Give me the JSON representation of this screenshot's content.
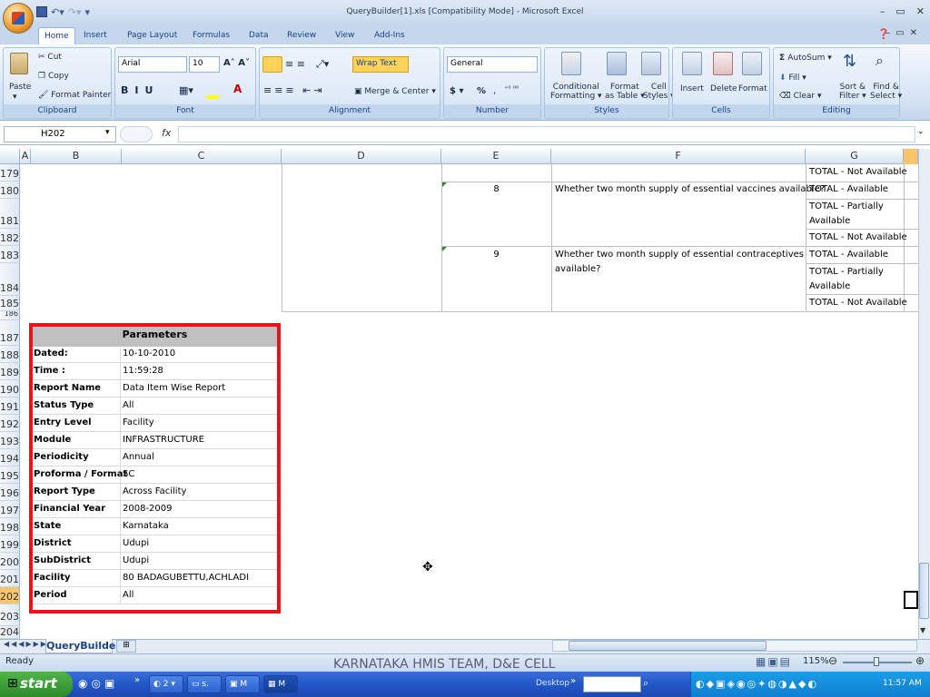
{
  "window": {
    "title": "QueryBuilder[1].xls  [Compatibility Mode] - Microsoft Excel"
  },
  "ribbon": {
    "tabs": [
      "Home",
      "Insert",
      "Page Layout",
      "Formulas",
      "Data",
      "Review",
      "View",
      "Add-Ins"
    ],
    "clipboard": {
      "cut": "Cut",
      "copy": "Copy",
      "paste": "Paste",
      "format_painter": "Format Painter",
      "label": "Clipboard"
    },
    "font": {
      "name": "Arial",
      "size": "10",
      "label": "Font"
    },
    "alignment": {
      "wrap": "Wrap Text",
      "merge": "Merge & Center",
      "label": "Alignment"
    },
    "number": {
      "format": "General",
      "label": "Number",
      "pct": "%"
    },
    "styles": {
      "conditional": "Conditional",
      "formatting": "Formatting",
      "format": "Format",
      "as_table": "as Table",
      "cell": "Cell",
      "styles": "Styles",
      "label": "Styles"
    },
    "cells": {
      "insert": "Insert",
      "delete": "Delete",
      "format": "Format",
      "label": "Cells"
    },
    "editing": {
      "autosum": "AutoSum",
      "fill": "Fill",
      "clear": "Clear",
      "sort": "Sort &",
      "filter": "Filter",
      "find": "Find &",
      "select": "Select",
      "label": "Editing"
    }
  },
  "formula_bar": {
    "name_box": "H202",
    "fx": "fx"
  },
  "columns": [
    "A",
    "B",
    "C",
    "D",
    "E",
    "F",
    "G"
  ],
  "rows": [
    "179",
    "180",
    "181",
    "182",
    "183",
    "184",
    "185",
    "186",
    "187",
    "188",
    "189",
    "190",
    "191",
    "192",
    "193",
    "194",
    "195",
    "196",
    "197",
    "198",
    "199",
    "200",
    "201",
    "202",
    "203",
    "204"
  ],
  "table": {
    "r179_g": "TOTAL - Not Available",
    "r180_e": "8",
    "r180_f": "Whether two month supply of essential vaccines available?",
    "r180_g": "TOTAL - Available",
    "r181_g1": "TOTAL - Partially",
    "r181_g2": "Available",
    "r182_g": "TOTAL - Not Available",
    "r183_e": "9",
    "r183_f1": "Whether two month supply of essential contraceptives",
    "r183_f2": "available?",
    "r183_g": "TOTAL - Available",
    "r184_g1": "TOTAL - Partially",
    "r184_g2": "Available",
    "r185_g": "TOTAL - Not Available"
  },
  "parameters": {
    "title": "Parameters",
    "items": [
      {
        "label": "Dated:",
        "value": "10-10-2010"
      },
      {
        "label": "Time :",
        "value": "11:59:28"
      },
      {
        "label": "Report Name",
        "value": "Data Item Wise Report"
      },
      {
        "label": "Status Type",
        "value": "All"
      },
      {
        "label": "Entry Level",
        "value": "Facility"
      },
      {
        "label": "Module",
        "value": "INFRASTRUCTURE"
      },
      {
        "label": "Periodicity",
        "value": "Annual"
      },
      {
        "label": "Proforma / Format",
        "value": "SC"
      },
      {
        "label": "Report Type",
        "value": "Across Facility"
      },
      {
        "label": "Financial Year",
        "value": "2008-2009"
      },
      {
        "label": "State",
        "value": "Karnataka"
      },
      {
        "label": "District",
        "value": "Udupi"
      },
      {
        "label": "SubDistrict",
        "value": "Udupi"
      },
      {
        "label": "Facility",
        "value": "80 BADAGUBETTU,ACHLADI"
      },
      {
        "label": "Period",
        "value": "All"
      }
    ]
  },
  "sheet_tab": "QueryBuilder",
  "status": {
    "ready": "Ready",
    "zoom": "115%"
  },
  "footer_caption": "KARNATAKA HMIS TEAM, D&E CELL",
  "taskbar": {
    "start": "start",
    "items": [
      "2",
      "s.",
      "M",
      "M"
    ],
    "desktop": "Desktop",
    "clock": "11:57 AM"
  }
}
